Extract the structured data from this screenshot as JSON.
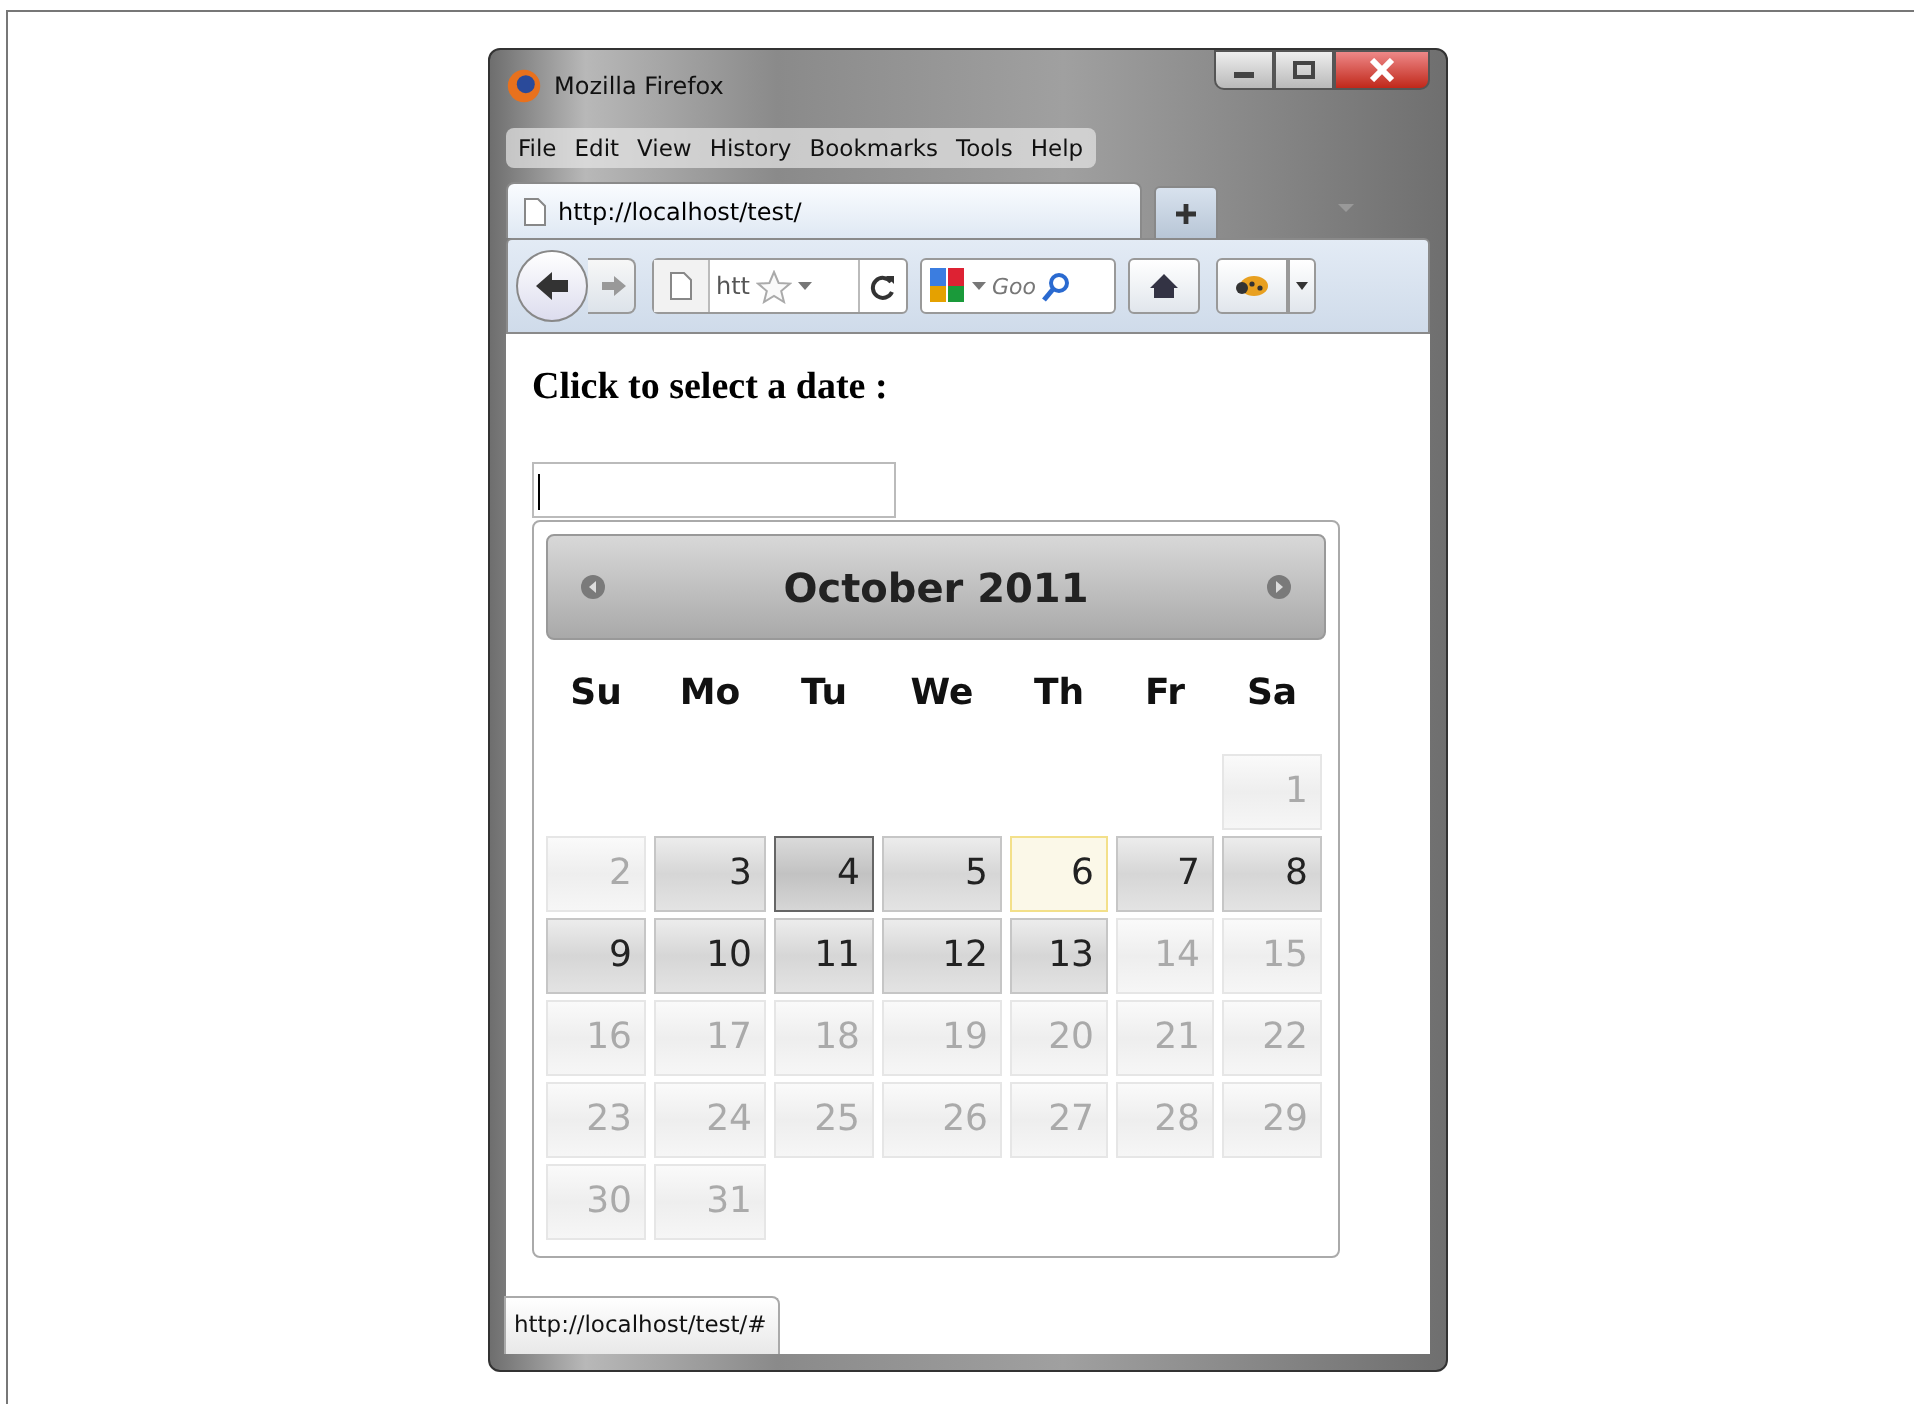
{
  "window": {
    "title": "Mozilla Firefox"
  },
  "menu": [
    "File",
    "Edit",
    "View",
    "History",
    "Bookmarks",
    "Tools",
    "Help"
  ],
  "tab": {
    "title": "http://localhost/test/",
    "selected": true
  },
  "toolbar": {
    "url": "htt",
    "search": "Goo"
  },
  "page": {
    "heading": "Click to select a date :"
  },
  "calendar": {
    "title": "October 2011",
    "weekdays": [
      "Su",
      "Mo",
      "Tu",
      "We",
      "Th",
      "Fr",
      "Sa"
    ],
    "weeks": [
      [
        {
          "day": "1",
          "kind": "disabled"
        }
      ],
      [
        {
          "day": "2",
          "kind": "disabled"
        },
        {
          "day": "3",
          "kind": "enabled"
        },
        {
          "day": "4",
          "kind": "hover"
        },
        {
          "day": "5",
          "kind": "enabled"
        },
        {
          "day": "6",
          "kind": "today"
        },
        {
          "day": "7",
          "kind": "enabled"
        },
        {
          "day": "8",
          "kind": "enabled"
        }
      ],
      [
        {
          "day": "9",
          "kind": "enabled"
        },
        {
          "day": "10",
          "kind": "enabled"
        },
        {
          "day": "11",
          "kind": "enabled"
        },
        {
          "day": "12",
          "kind": "enabled"
        },
        {
          "day": "13",
          "kind": "enabled"
        },
        {
          "day": "14",
          "kind": "disabled"
        },
        {
          "day": "15",
          "kind": "disabled"
        }
      ],
      [
        {
          "day": "16",
          "kind": "disabled"
        },
        {
          "day": "17",
          "kind": "disabled"
        },
        {
          "day": "18",
          "kind": "disabled"
        },
        {
          "day": "19",
          "kind": "disabled"
        },
        {
          "day": "20",
          "kind": "disabled"
        },
        {
          "day": "21",
          "kind": "disabled"
        },
        {
          "day": "22",
          "kind": "disabled"
        }
      ],
      [
        {
          "day": "23",
          "kind": "disabled"
        },
        {
          "day": "24",
          "kind": "disabled"
        },
        {
          "day": "25",
          "kind": "disabled"
        },
        {
          "day": "26",
          "kind": "disabled"
        },
        {
          "day": "27",
          "kind": "disabled"
        },
        {
          "day": "28",
          "kind": "disabled"
        },
        {
          "day": "29",
          "kind": "disabled"
        }
      ],
      [
        {
          "day": "30",
          "kind": "disabled"
        },
        {
          "day": "31",
          "kind": "disabled"
        }
      ]
    ]
  },
  "status_bar": {
    "text": "http://localhost/test/#"
  }
}
